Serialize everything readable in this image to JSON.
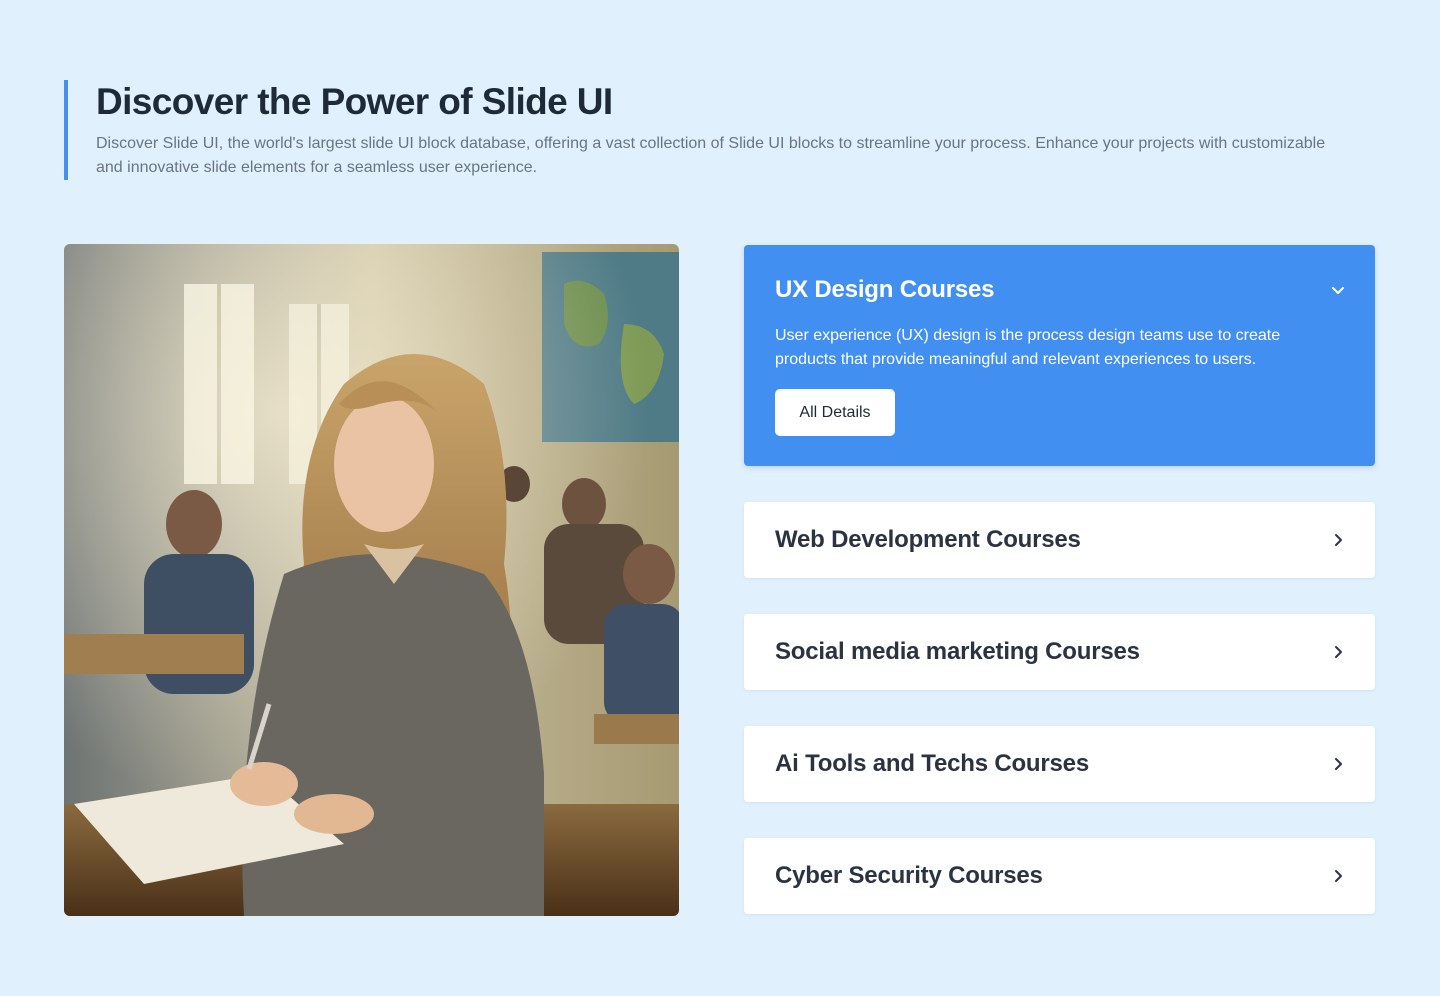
{
  "header": {
    "title": "Discover the Power of Slide UI",
    "description": "Discover Slide UI, the world's largest slide UI block database, offering a vast collection of Slide UI blocks to streamline your process. Enhance your projects with customizable and innovative slide elements for a seamless user experience."
  },
  "accordion": {
    "open_item": {
      "title": "UX Design Courses",
      "description": "User experience (UX) design is the process design teams use to create products that provide meaningful and relevant experiences to users.",
      "button_label": "All Details",
      "icon": "chevron-down-icon"
    },
    "items": [
      {
        "title": "Web Development Courses",
        "icon": "chevron-right-icon"
      },
      {
        "title": "Social media marketing Courses",
        "icon": "chevron-right-icon"
      },
      {
        "title": "Ai Tools and Techs Courses",
        "icon": "chevron-right-icon"
      },
      {
        "title": "Cyber Security Courses",
        "icon": "chevron-right-icon"
      }
    ]
  },
  "colors": {
    "background": "#e1f0fd",
    "accent": "#418ff0",
    "heading": "#1f2a37",
    "body_text": "#6b7482"
  }
}
